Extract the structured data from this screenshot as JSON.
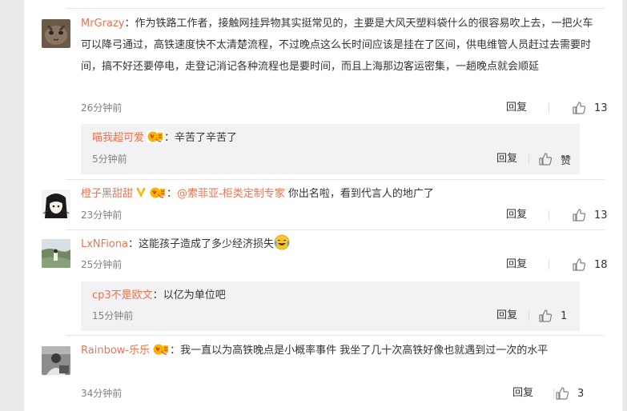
{
  "comments": [
    {
      "username": "MrGrazy",
      "colon": "：",
      "text": "作为铁路工作者，接触网挂异物其实挺常见的，主要是大风天塑料袋什么的很容易吹上去，一把火车可以降弓通过，高铁速度快不太清楚流程，不过晚点这么长时间应该是挂在了区间，供电维管人员赶过去需要时间，搞不好还要停电，走登记消记各种流程也是要时间，而且上海那边客运密集，一趟晚点就会顺延",
      "time": "26分钟前",
      "reply": "回复",
      "likes": "13",
      "avatar_icon": "cat-avatar-icon"
    },
    {
      "username": "喵我超可爱",
      "colon": "：",
      "text": "辛苦了辛苦了",
      "time": "5分钟前",
      "reply": "回复",
      "likes": "赞",
      "badge_icon": "member-badge-icon"
    },
    {
      "username": "橙子黑甜甜",
      "colon": "：",
      "mention": "@索菲亚-柜类定制专家",
      "text": " 你出名啦，看到代言人的地广了",
      "time": "23分钟前",
      "reply": "回复",
      "likes": "13",
      "avatar_icon": "anime-girl-avatar-icon",
      "badge_icons": [
        "verified-v-icon",
        "member-badge-icon"
      ]
    },
    {
      "username": "LxNFiona",
      "colon": "：",
      "text": "这能孩子造成了多少经济损失",
      "time": "25分钟前",
      "reply": "回复",
      "likes": "18",
      "avatar_icon": "outdoor-photo-avatar-icon",
      "emoji_icon": "crying-laughing-emoji-icon"
    },
    {
      "username": "cp3不是欧文",
      "colon": "：",
      "text": "以亿为单位吧",
      "time": "15分钟前",
      "reply": "回复",
      "likes": "1"
    },
    {
      "username": "Rainbow-乐乐",
      "colon": "：",
      "text": "我一直以为高铁晚点是小概率事件 我坐了几十次高铁好像也就遇到过一次的水平",
      "time": "34分钟前",
      "reply": "回复",
      "likes": "3",
      "avatar_icon": "person-photo-avatar-icon",
      "badge_icon": "member-badge-icon"
    }
  ],
  "colors": {
    "username": "#eb7350",
    "text": "#333333",
    "meta": "#808080",
    "sub_bg": "#f2f2f5",
    "page_bg": "#e9eaec"
  }
}
